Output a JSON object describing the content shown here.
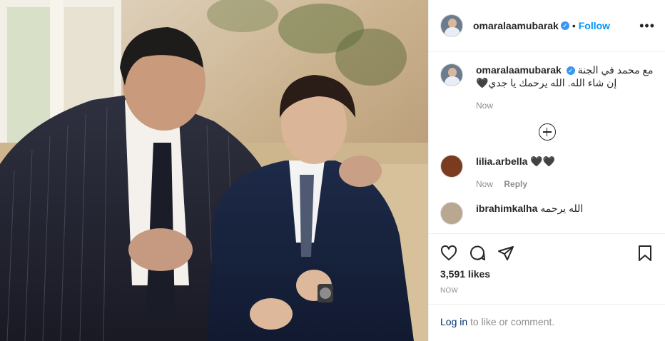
{
  "post": {
    "image_alt": "Photo of an elderly man in a pinstriped suit talking to a boy in a navy suit on a sofa"
  },
  "header": {
    "username": "omaralaamubarak",
    "verified_mark": "✓",
    "separator": "•",
    "follow_label": "Follow",
    "more_label": "•••"
  },
  "caption": {
    "username": "omaralaamubarak",
    "text": "مع محمد في الجنة إن شاء الله. الله يرحمك يا جدي🖤",
    "time": "Now"
  },
  "comments": [
    {
      "username": "lilia.arbella",
      "text": "🖤🖤",
      "time": "Now",
      "reply_label": "Reply"
    },
    {
      "username": "ibrahimkalha",
      "text": "الله يرحمه"
    }
  ],
  "footer": {
    "likes": "3,591 likes",
    "timestamp": "NOW",
    "login_link": "Log in",
    "login_rest": " to like or comment."
  },
  "icons": [
    "heart-icon",
    "comment-icon",
    "share-icon",
    "bookmark-icon",
    "add-comments-icon",
    "verified-icon"
  ],
  "colors": {
    "accent": "#0095f6",
    "muted": "#8e8e8e",
    "text": "#262626",
    "link": "#00376b"
  }
}
